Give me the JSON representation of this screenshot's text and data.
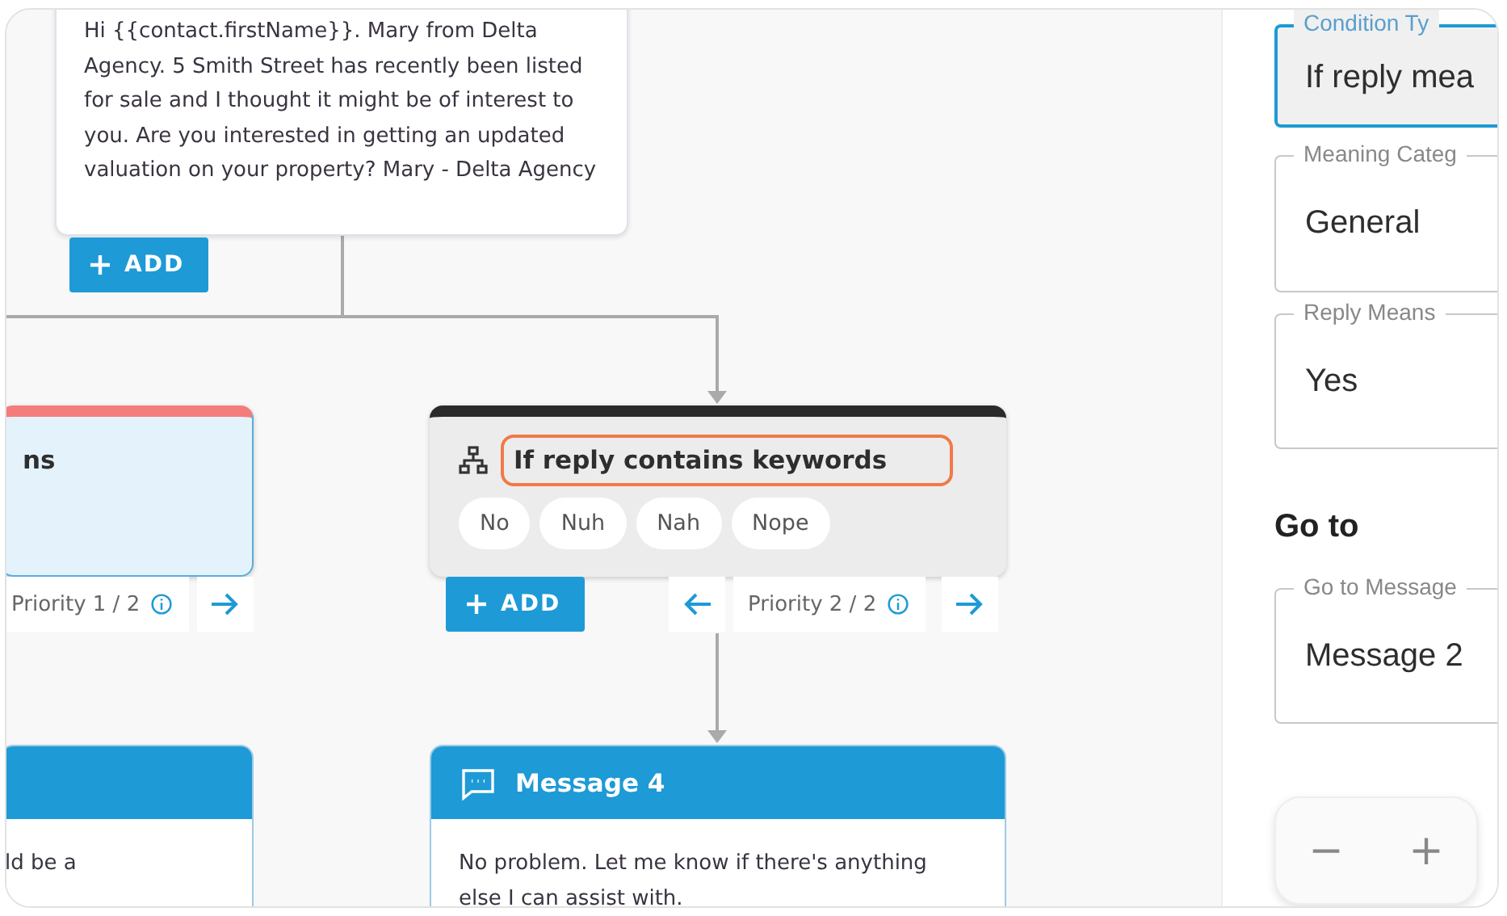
{
  "canvas": {
    "top_message": {
      "text": "Hi {{contact.firstName}}. Mary from Delta Agency. 5 Smith Street has recently been listed for sale and I thought it might be of interest to you. Are you interested in getting an updated valuation on your property? Mary - Delta Agency",
      "add_label": "ADD"
    },
    "conditions": [
      {
        "title": "ns",
        "color": "#f47c7c",
        "selected": true,
        "editing": false,
        "priority": "Priority 1 / 2",
        "has_prev": false,
        "has_next": true
      },
      {
        "title": "If reply contains keywords",
        "color": "#2b2b2b",
        "selected": false,
        "editing": true,
        "keywords": [
          "No",
          "Nuh",
          "Nah",
          "Nope"
        ],
        "priority": "Priority 2 / 2",
        "has_prev": true,
        "has_next": true,
        "add_label": "ADD"
      }
    ],
    "bottom_messages": [
      {
        "text": "ld be a"
      },
      {
        "title": "Message 4",
        "text": "No problem. Let me know if there's anything else I can assist with."
      }
    ]
  },
  "panel": {
    "fields": [
      {
        "label": "Condition Ty",
        "value": "If reply mea",
        "focused": true
      },
      {
        "label": "Meaning Categ",
        "value": "General",
        "focused": false
      },
      {
        "label": "Reply Means",
        "value": "Yes",
        "focused": false
      }
    ],
    "goto_heading": "Go to",
    "goto_fields": [
      {
        "label": "Go to Message",
        "value": "Message 2",
        "focused": false
      }
    ],
    "zoom": {
      "minus": "−",
      "plus": "+"
    }
  }
}
